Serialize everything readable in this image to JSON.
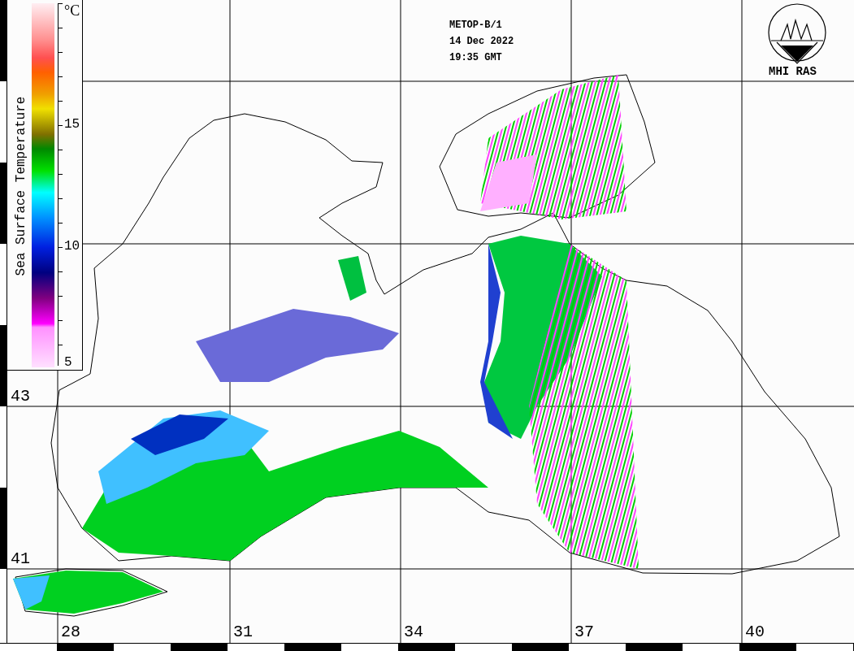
{
  "colorbar": {
    "title": "Sea Surface Temperature",
    "unit": "°C",
    "ticks": [
      "15",
      "10",
      "5"
    ]
  },
  "header": {
    "satellite": "METOP-B/1",
    "date": "14 Dec 2022",
    "time": "19:35 GMT"
  },
  "logo": {
    "label": "MHI RAS"
  },
  "latitude_labels": [
    "43",
    "41"
  ],
  "longitude_labels": [
    "28",
    "31",
    "34",
    "37",
    "40"
  ]
}
